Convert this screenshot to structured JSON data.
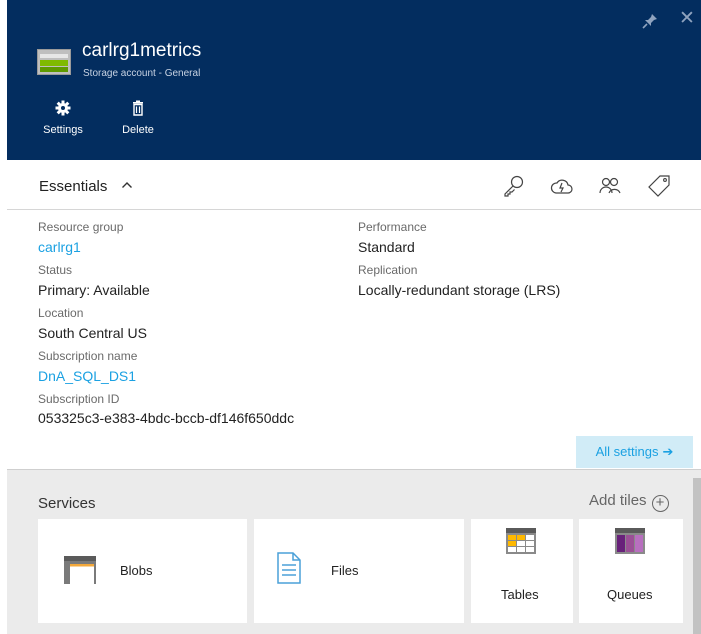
{
  "header": {
    "title": "carlrg1metrics",
    "subtitle": "Storage account - General",
    "commands": [
      {
        "label": "Settings",
        "icon": "gear-icon"
      },
      {
        "label": "Delete",
        "icon": "trash-icon"
      }
    ],
    "pin_icon": "pin-icon",
    "close_icon": "close-icon",
    "background": "#032d5f"
  },
  "essentials": {
    "title": "Essentials",
    "toolbar_icons": [
      "key-icon",
      "cloud-icon",
      "users-icon",
      "tag-icon"
    ],
    "left_fields": [
      {
        "label": "Resource group",
        "value": "carlrg1",
        "is_link": true
      },
      {
        "label": "Status",
        "value": "Primary: Available",
        "is_link": false
      },
      {
        "label": "Location",
        "value": "South Central US",
        "is_link": false
      },
      {
        "label": "Subscription name",
        "value": "DnA_SQL_DS1",
        "is_link": true
      },
      {
        "label": "Subscription ID",
        "value": "053325c3-e383-4bdc-bccb-df146f650ddc",
        "is_link": false
      }
    ],
    "right_fields": [
      {
        "label": "Performance",
        "value": "Standard"
      },
      {
        "label": "Replication",
        "value": "Locally-redundant storage (LRS)"
      }
    ],
    "all_settings_label": "All settings",
    "link_color": "#1ba1e2"
  },
  "services": {
    "title": "Services",
    "add_tiles_label": "Add tiles",
    "tiles": [
      {
        "label": "Blobs",
        "icon": "blob-container-icon"
      },
      {
        "label": "Files",
        "icon": "file-icon"
      },
      {
        "label": "Tables",
        "icon": "table-icon"
      },
      {
        "label": "Queues",
        "icon": "queue-icon"
      }
    ]
  }
}
